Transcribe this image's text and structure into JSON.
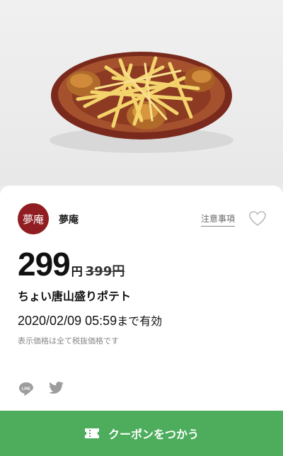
{
  "shop": {
    "logo_text": "夢庵",
    "name": "夢庵"
  },
  "notes_label": "注意事項",
  "price": {
    "current": "299",
    "currency": "円",
    "original": "399円"
  },
  "item_name": "ちょい唐山盛りポテト",
  "validity": {
    "date": "2020/02/09 05:59",
    "suffix": "まで有効"
  },
  "tax_note": "表示価格は全て税抜価格です",
  "cta": {
    "label": "クーポンをつかう"
  },
  "icons": {
    "heart": "heart-icon",
    "line": "line-icon",
    "twitter": "twitter-icon",
    "ticket": "ticket-icon"
  },
  "colors": {
    "brand": "#8f1d21",
    "cta": "#4dad5d"
  }
}
